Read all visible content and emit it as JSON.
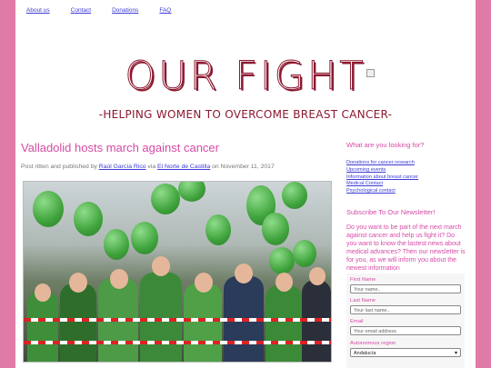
{
  "nav": {
    "items": [
      "About us",
      "Contact",
      "Donations",
      "FAQ"
    ]
  },
  "logo": {
    "title": "OUR FIGHT",
    "subtitle": "-HELPING WOMEN TO OVERCOME BREAST CANCER-"
  },
  "post": {
    "title": "Valladolid hosts march against cancer",
    "byline_prefix": "Post ritten and published by",
    "author": "Raúl García Rico",
    "via": "via",
    "source": "El Norte de Castilla",
    "date_text": "on November 11, 2017"
  },
  "sidebar": {
    "heading": "What are you looking for?",
    "links": [
      "Donations for cancer research",
      "Upcoming events",
      "Information about breast cancer",
      "Medical Contact",
      "Psychological contact"
    ],
    "newsletter_heading": "Subscribe To Our Newsletter!",
    "newsletter_text": "Do you want to be part of the next march against cancer and help us fight it? Do you want to know the lastest news about medical advances? Then our newsletter is for you, as we will inform you about the newest information"
  },
  "form": {
    "first_label": "First Name",
    "first_placeholder": "Your name..",
    "last_label": "Last Name",
    "last_placeholder": "Your last name..",
    "email_label": "Email",
    "email_placeholder": "Your email address",
    "region_label": "Autonomous region",
    "region_value": "Andalucía"
  },
  "colors": {
    "background": "#e07aa6",
    "accent": "#d64aa6",
    "logo": "#8c1830",
    "link": "#3b3bd6"
  }
}
